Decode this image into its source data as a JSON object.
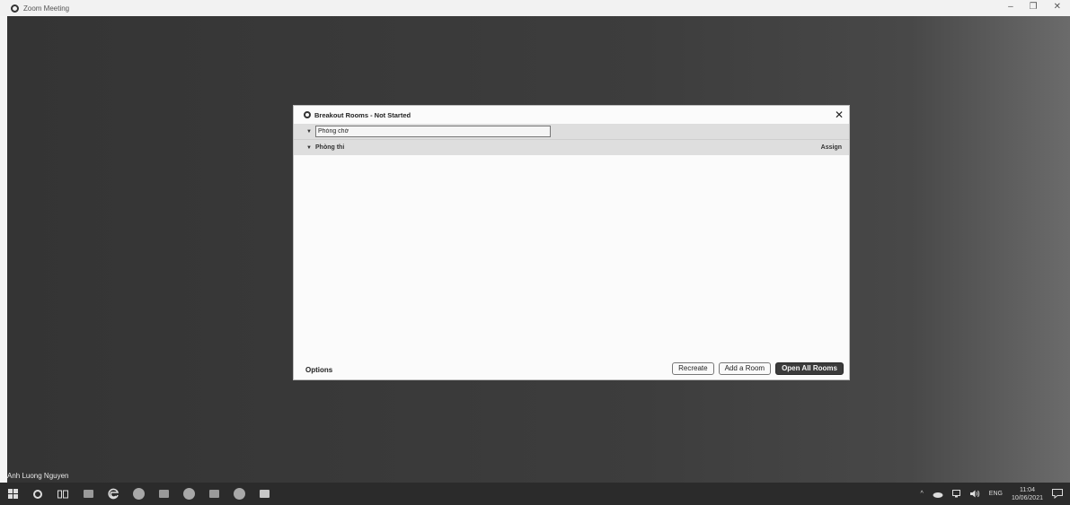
{
  "window": {
    "title": "Zoom Meeting",
    "controls": {
      "minimize": "–",
      "restore": "❐",
      "close": "✕"
    }
  },
  "meeting": {
    "participant_name": "Anh Luong Nguyen"
  },
  "dialog": {
    "title": "Breakout Rooms - Not Started",
    "close": "✕",
    "rooms": [
      {
        "arrow": "▼",
        "name": "Phòng chờ",
        "editing": true
      },
      {
        "arrow": "▼",
        "name": "Phòng thi",
        "assign_label": "Assign"
      }
    ],
    "options_label": "Options",
    "buttons": {
      "recreate": "Recreate",
      "add_room": "Add a Room",
      "open_all": "Open All Rooms"
    }
  },
  "taskbar": {
    "tray": {
      "chevron": "^",
      "language": "ENG",
      "time": "11:04",
      "date": "10/06/2021"
    }
  }
}
